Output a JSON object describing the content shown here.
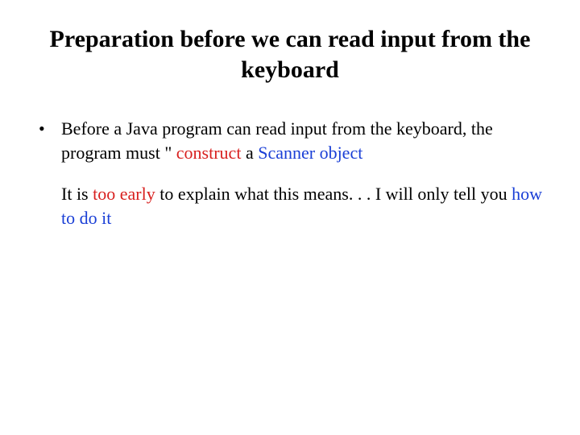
{
  "title": "Preparation before we can read input from the keyboard",
  "bullet1": {
    "t1": "Before a Java program can read input from the keyboard, the program must \" ",
    "construct": "construct",
    "space_a": " a ",
    "scanner_object": "Scanner object"
  },
  "para2": {
    "lead": " It is ",
    "too_early": "too early",
    "mid": " to explain what this means. . . I will only tell you ",
    "how_to_do_it": "how to do it"
  }
}
